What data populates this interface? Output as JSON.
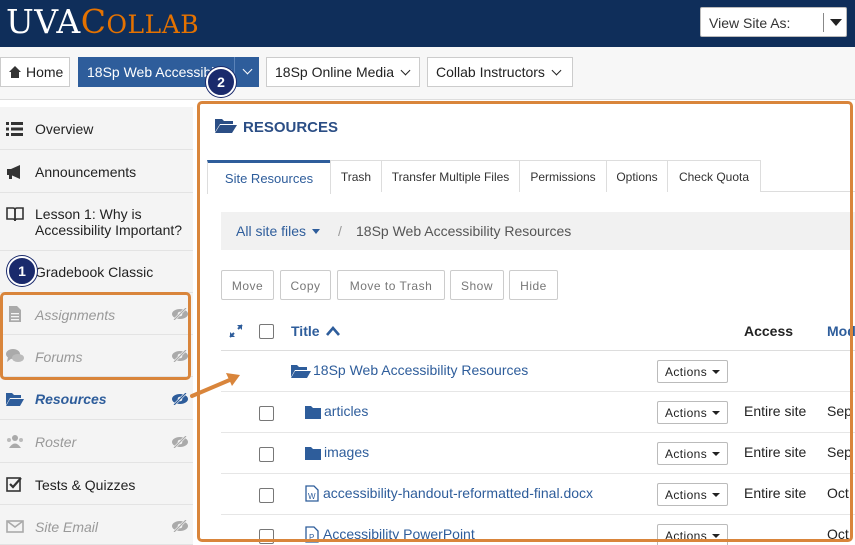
{
  "header": {
    "logo_uva": "UVA",
    "logo_c": "C",
    "logo_rest": "OLLAB",
    "view_site_as": "View Site As:"
  },
  "site_nav": {
    "home": "Home",
    "sites": [
      "18Sp Web Accessibility",
      "18Sp Online Media",
      "Collab Instructors"
    ]
  },
  "sidebar": {
    "items": [
      {
        "label": "Overview",
        "icon": "list-icon",
        "state": "normal"
      },
      {
        "label": "Announcements",
        "icon": "megaphone-icon",
        "state": "normal"
      },
      {
        "label": "Lesson 1: Why is Accessibility Important?",
        "icon": "book-icon",
        "state": "normal"
      },
      {
        "label": "Gradebook Classic",
        "icon": "gradebook-icon",
        "state": "normal"
      },
      {
        "label": "Assignments",
        "icon": "file-icon",
        "state": "hidden"
      },
      {
        "label": "Forums",
        "icon": "comments-icon",
        "state": "hidden"
      },
      {
        "label": "Resources",
        "icon": "folder-open-icon",
        "state": "current-hidden"
      },
      {
        "label": "Roster",
        "icon": "users-icon",
        "state": "hidden"
      },
      {
        "label": "Tests & Quizzes",
        "icon": "checkbox-icon",
        "state": "normal"
      },
      {
        "label": "Site Email",
        "icon": "envelope-icon",
        "state": "hidden"
      }
    ]
  },
  "main": {
    "title": "RESOURCES",
    "tabs": [
      "Site Resources",
      "Trash",
      "Transfer Multiple Files",
      "Permissions",
      "Options",
      "Check Quota"
    ],
    "breadcrumb": {
      "root": "All site files",
      "separator": "/",
      "current": "18Sp Web Accessibility Resources"
    },
    "buttons": [
      "Move",
      "Copy",
      "Move to Trash",
      "Show",
      "Hide"
    ],
    "columns": {
      "title": "Title",
      "access": "Access",
      "modified": "Mod"
    },
    "actions_label": "Actions",
    "rows": [
      {
        "name": "18Sp Web Accessibility Resources",
        "type": "folder-open",
        "access": "",
        "modified": ""
      },
      {
        "name": "articles",
        "type": "folder",
        "access": "Entire site",
        "modified": "Sep"
      },
      {
        "name": "images",
        "type": "folder",
        "access": "Entire site",
        "modified": "Sep"
      },
      {
        "name": "accessibility-handout-reformatted-final.docx",
        "type": "word",
        "access": "Entire site",
        "modified": "Oct"
      },
      {
        "name": "Accessibility PowerPoint",
        "type": "powerpoint",
        "access": "",
        "modified": "Oct"
      }
    ]
  },
  "annotations": {
    "badge1": "1",
    "badge2": "2"
  },
  "colors": {
    "header_bg": "#0f2e5a",
    "logo_orange": "#e57200",
    "accent_blue": "#2e5d9b",
    "highlight": "#d9853b",
    "badge_bg": "#1a2a6c"
  }
}
